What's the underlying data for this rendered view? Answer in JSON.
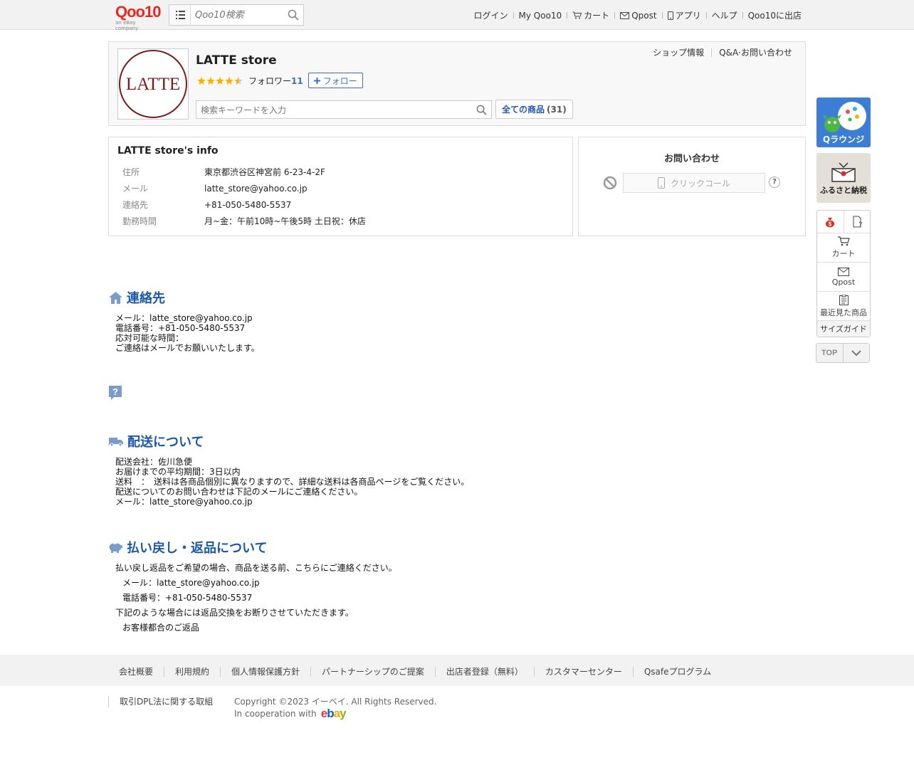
{
  "header": {
    "logo_text": "Qoo10",
    "logo_sub": "an eBay company",
    "search_placeholder": "Qoo10検索",
    "nav": [
      "ログイン",
      "My Qoo10",
      "カート",
      "Qpost",
      "アプリ",
      "ヘルプ",
      "Qoo10に出店"
    ]
  },
  "shop": {
    "logo_text": "LATTE",
    "name": "LATTE store",
    "rating_stars": 4.5,
    "follower_label": "フォロワー",
    "follower_count": "11",
    "follow_button": "フォロー",
    "links": [
      "ショップ情報",
      "Q&A·お問い合わせ"
    ],
    "search_placeholder": "検索キーワードを入力",
    "all_products_label": "全ての商品",
    "all_products_count": "(31)"
  },
  "info": {
    "title": "LATTE store's info",
    "rows": [
      {
        "key": "住所",
        "value": "東京都渋谷区神宮前 6-23-4-2F"
      },
      {
        "key": "メール",
        "value": "latte_store@yahoo.co.jp"
      },
      {
        "key": "連絡先",
        "value": "+81-050-5480-5537"
      },
      {
        "key": "勤務時間",
        "value": "月~金：午前10時~午後5時 土日祝：休店"
      }
    ]
  },
  "contact": {
    "title": "お問い合わせ",
    "click_call": "クリックコール",
    "help": "?"
  },
  "sections": {
    "contact": {
      "title": "連絡先",
      "lines": [
        "メール：latte_store@yahoo.co.jp",
        "電話番号：+81-050-5480-5537",
        "応対可能な時間：",
        "ご連絡はメールでお願いいたします。"
      ]
    },
    "shipping": {
      "title": "配送について",
      "lines": [
        "配送会社：佐川急便",
        "お届けまでの平均期間：3日以内",
        "送料　：　送料は各商品個別に異なりますので、詳細な送料は各商品ページをご覧ください。",
        "配送についてのお問い合わせは下記のメールにご連絡ください。",
        "メール：latte_store@yahoo.co.jp"
      ]
    },
    "refund": {
      "title": "払い戻し・返品について",
      "lines": [
        {
          "text": "払い戻し返品をご希望の場合、商品を送る前、こちらにご連絡ください。",
          "indent": false
        },
        {
          "text": "メール：latte_store@yahoo.co.jp",
          "indent": true
        },
        {
          "text": "電話番号：+81-050-5480-5537",
          "indent": true
        },
        {
          "text": "下記のような場合には返品交換をお断りさせていただきます。",
          "indent": false
        },
        {
          "text": "お客様都合のご返品",
          "indent": true
        }
      ]
    }
  },
  "sidebar": {
    "qlounge": "Qラウンジ",
    "furusato": "ふるさと納税",
    "items": [
      "カート",
      "Qpost",
      "最近見た商品"
    ],
    "size_guide": "サイズガイド",
    "top": "TOP"
  },
  "footer": {
    "links": [
      "会社概要",
      "利用規約",
      "個人情報保護方針",
      "パートナーシップのご提案",
      "出店者登録（無料）",
      "カスタマーセンター",
      "Qsafeプログラム"
    ],
    "dpl": "取引DPL法に関する取組",
    "copyright": "Copyright ©2023 イーベイ. All Rights Reserved.",
    "cooperation": "In cooperation with",
    "ebay_logo": "ebay"
  },
  "colors": {
    "accent_blue": "#1c58a8",
    "link_blue": "#3a6fc4",
    "qoo10_red": "#e8281e",
    "star": "#f5b400"
  }
}
